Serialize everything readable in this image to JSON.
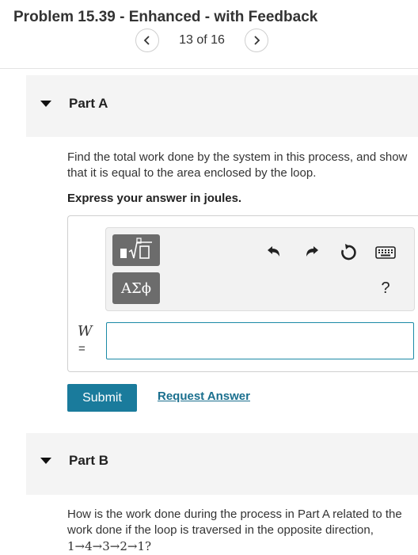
{
  "header": {
    "title": "Problem 15.39 - Enhanced - with Feedback",
    "counter": "13 of 16",
    "prev_icon": "chevron-left-icon",
    "next_icon": "chevron-right-icon"
  },
  "part_a": {
    "title": "Part A",
    "question": "Find the total work done by the system in this process, and show that it is equal to the area enclosed by the loop.",
    "instruction": "Express your answer in joules.",
    "toolbar": {
      "templates_icon": "templates-icon",
      "greek_label": "ΑΣϕ",
      "undo_icon": "undo-icon",
      "redo_icon": "redo-icon",
      "reset_icon": "reset-icon",
      "keyboard_icon": "keyboard-icon",
      "help_label": "?"
    },
    "variable": "W",
    "equals": "=",
    "answer_value": "",
    "submit_label": "Submit",
    "request_label": "Request Answer"
  },
  "part_b": {
    "title": "Part B",
    "question_text": "How is the work done during the process in Part A related to the work done if the loop is traversed in the opposite direction,",
    "question_math": "1→4→3→2→1?"
  },
  "colors": {
    "accent": "#1a7b9c",
    "link": "#1a6f8e",
    "input_border": "#1b8aa6",
    "panel": "#f4f4f4",
    "tool_button": "#6c6c6c"
  }
}
